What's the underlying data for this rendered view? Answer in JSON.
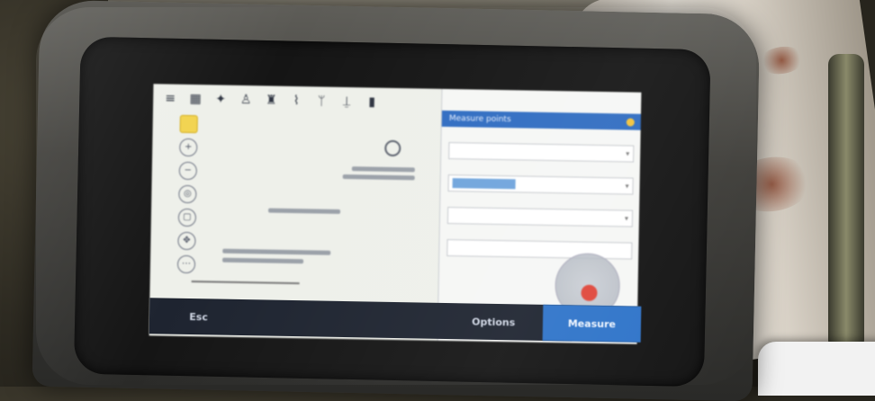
{
  "device": {
    "softkeys": [
      {
        "label": "Esc"
      },
      {
        "label": ""
      },
      {
        "label": ""
      },
      {
        "label": "Options"
      },
      {
        "label": "Measure"
      }
    ]
  },
  "panel": {
    "header_label": "Measure points"
  },
  "colors": {
    "accent": "#2f74c9",
    "header": "#2f6cc1",
    "record_button": "#e0483c",
    "active_tool": "#f2d34e"
  }
}
